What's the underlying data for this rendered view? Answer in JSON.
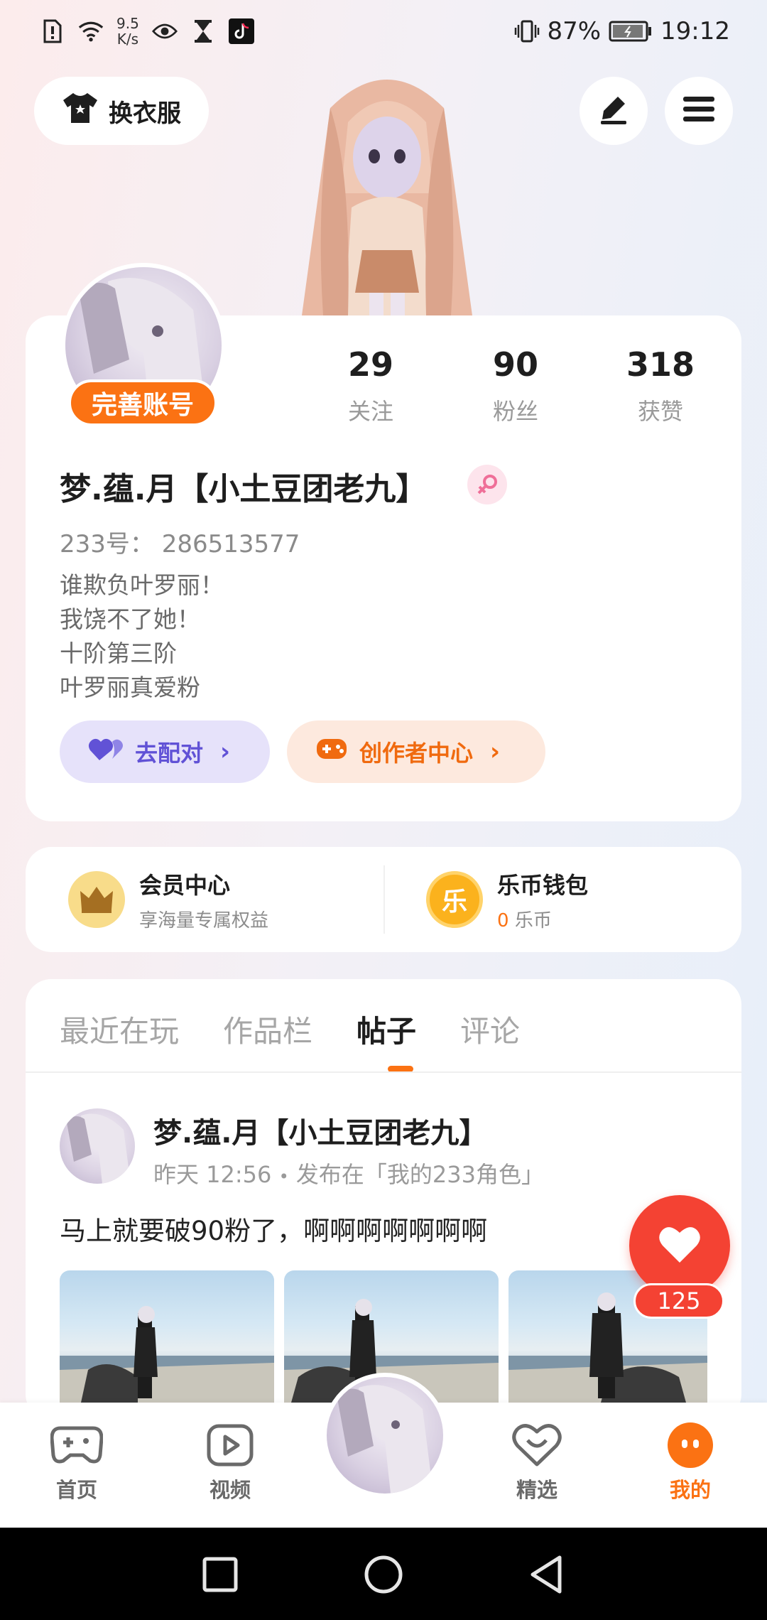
{
  "status_bar": {
    "net_speed_value": "9.5",
    "net_speed_unit": "K/s",
    "battery": "87%",
    "time": "19:12",
    "icons": [
      "sim-alert-icon",
      "wifi-icon",
      "eye-icon",
      "hourglass-icon",
      "tiktok-icon",
      "vibrate-icon",
      "battery-icon"
    ]
  },
  "top": {
    "outfit_label": "换衣服",
    "edit_icon": "pen-icon",
    "menu_icon": "menu-icon"
  },
  "profile": {
    "complete_label": "完善账号",
    "stats": [
      {
        "value": "29",
        "label": "关注"
      },
      {
        "value": "90",
        "label": "粉丝"
      },
      {
        "value": "318",
        "label": "获赞"
      }
    ],
    "username": "梦.蕴.月【小土豆团老九】",
    "gender": "female",
    "uid": "233号： 286513577",
    "bio": [
      "谁欺负叶罗丽！",
      "我饶不了她！",
      "十阶第三阶",
      "叶罗丽真爱粉"
    ],
    "match_label": "去配对",
    "creator_label": "创作者中心",
    "colors": {
      "accent": "#fb7213",
      "match": "#6152d6"
    }
  },
  "member_wallet": {
    "member_title": "会员中心",
    "member_sub": "享海量专属权益",
    "wallet_title": "乐币钱包",
    "wallet_icon_char": "乐",
    "coin_amount": "0",
    "coin_unit": "乐币"
  },
  "tabs": [
    {
      "label": "最近在玩",
      "active": false
    },
    {
      "label": "作品栏",
      "active": false
    },
    {
      "label": "帖子",
      "active": true
    },
    {
      "label": "评论",
      "active": false
    }
  ],
  "post": {
    "author": "梦.蕴.月【小土豆团老九】",
    "time": "昨天 12:56",
    "separator": "•",
    "published_in": "发布在「我的233角色」",
    "text": "马上就要破90粉了，啊啊啊啊啊啊啊",
    "image_count": 3
  },
  "like": {
    "count": "125"
  },
  "bottom_nav": [
    {
      "label": "首页",
      "icon": "gamepad-icon",
      "active": false
    },
    {
      "label": "视频",
      "icon": "video-play-icon",
      "active": false
    },
    {
      "label": "",
      "icon": "avatar",
      "active": false
    },
    {
      "label": "精选",
      "icon": "heart-chat-icon",
      "active": false
    },
    {
      "label": "我的",
      "icon": "profile-face-icon",
      "active": true
    }
  ],
  "system_nav": [
    "recents-icon",
    "home-circle-icon",
    "back-triangle-icon"
  ]
}
